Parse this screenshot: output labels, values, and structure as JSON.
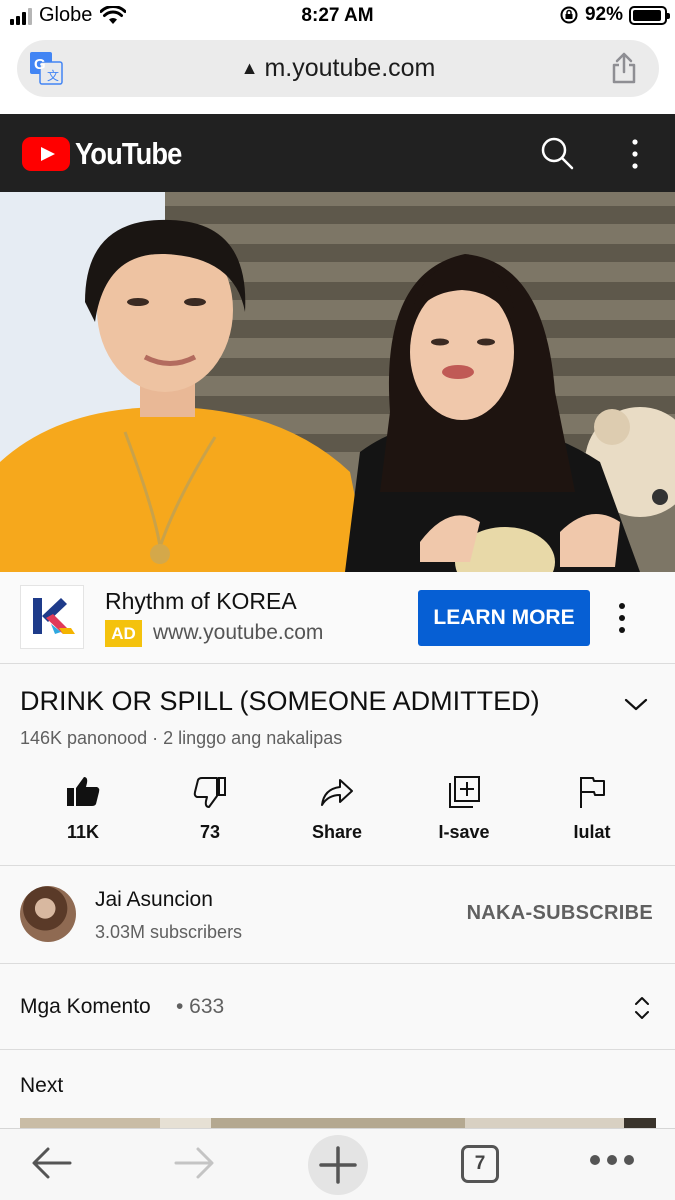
{
  "status_bar": {
    "carrier": "Globe",
    "time": "8:27 AM",
    "battery": "92%"
  },
  "browser": {
    "url": "m.youtube.com",
    "tab_count": "7"
  },
  "header": {
    "logo_text": "YouTube",
    "brand_color": "#ff0000"
  },
  "ad": {
    "title": "Rhythm of KOREA",
    "badge": "AD",
    "url": "www.youtube.com",
    "cta": "LEARN MORE",
    "cta_color": "#065fd4"
  },
  "video": {
    "title": "DRINK OR SPILL (SOMEONE ADMITTED)",
    "meta": "146K panonood · 2 linggo ang nakalipas",
    "actions": [
      {
        "icon": "thumbs-up-icon",
        "label": "11K"
      },
      {
        "icon": "thumbs-down-icon",
        "label": "73"
      },
      {
        "icon": "share-icon",
        "label": "Share"
      },
      {
        "icon": "add-to-playlist-icon",
        "label": "I-save"
      },
      {
        "icon": "flag-icon",
        "label": "Iulat"
      }
    ]
  },
  "channel": {
    "name": "Jai Asuncion",
    "subscribers": "3.03M subscribers",
    "subscribe_state": "NAKA-SUBSCRIBE"
  },
  "comments": {
    "label": "Mga Komento",
    "count": "• 633"
  },
  "next": {
    "label": "Next"
  }
}
